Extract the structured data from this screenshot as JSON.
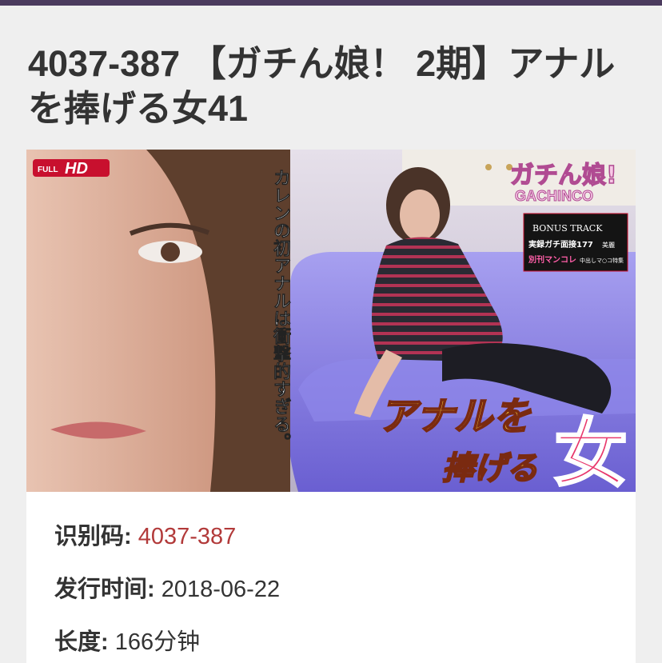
{
  "page": {
    "title": "4037-387 【ガチん娘！ 2期】アナルを捧げる女41"
  },
  "cover": {
    "badge_full": "FULL",
    "badge_hd": "HD",
    "logo_jp": "ガチん娘!",
    "logo_en": "GACHINCO",
    "bonus_title": "BONUS TRACK",
    "bonus_line1": "実録ガチ面接177",
    "bonus_line1_tag": "美麗",
    "bonus_line2": "別刊マンコレ",
    "bonus_line2_tag": "中出しマ○コ特集",
    "tagline": "カレンの初アナルは衝撃的すぎる。",
    "headline_1": "アナルを",
    "headline_2": "捧げる",
    "headline_big": "女"
  },
  "details": {
    "id_label": "识别码:",
    "id_value": "4037-387",
    "date_label": "发行时间:",
    "date_value": "2018-06-22",
    "length_label": "长度:",
    "length_value": "166分钟"
  },
  "colors": {
    "topbar": "#4b3b5e",
    "accent_red": "#b23a3a",
    "page_bg": "#efefef"
  }
}
